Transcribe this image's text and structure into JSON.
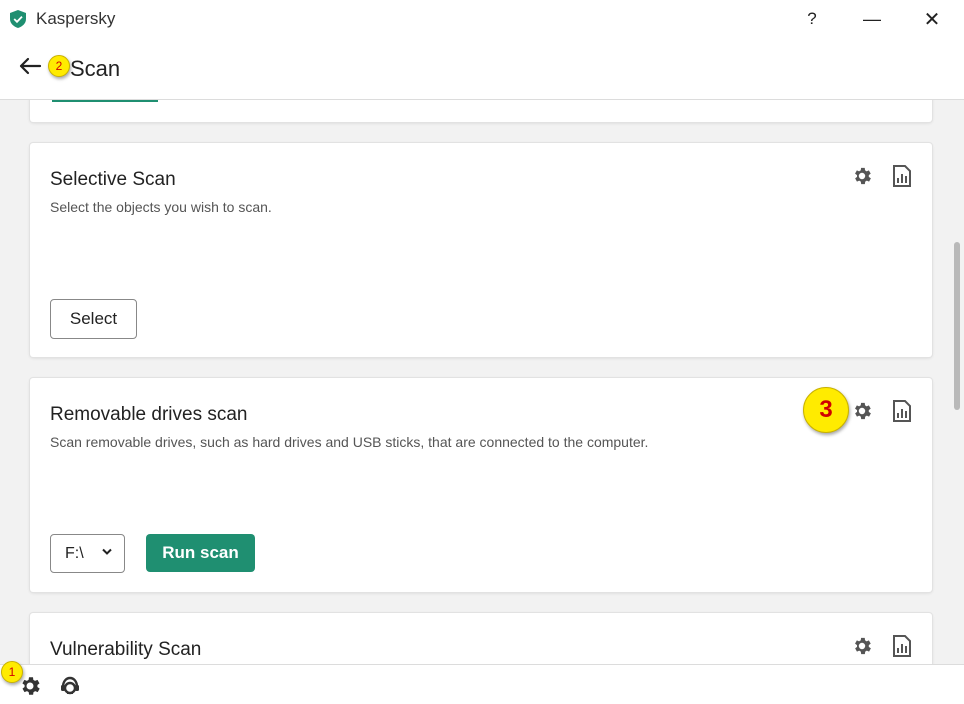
{
  "window": {
    "title": "Kaspersky",
    "help_label": "?",
    "minimize_label": "—",
    "close_label": "✕"
  },
  "header": {
    "title": "Scan"
  },
  "annotations": {
    "marker_1": "1",
    "marker_2": "2",
    "marker_3": "3"
  },
  "cards": {
    "selective": {
      "title": "Selective Scan",
      "description": "Select the objects you wish to scan.",
      "button_label": "Select"
    },
    "removable": {
      "title": "Removable drives scan",
      "description": "Scan removable drives, such as hard drives and USB sticks, that are connected to the computer.",
      "drive_value": "F:\\",
      "run_label": "Run scan"
    },
    "vulnerability": {
      "title": "Vulnerability Scan"
    }
  },
  "colors": {
    "accent": "#1f8f71",
    "marker": "#ffeb00",
    "marker_text": "#d00000"
  },
  "icons": {
    "settings": "gear-icon",
    "reports": "report-icon",
    "support": "support-icon",
    "back": "arrow-left-icon",
    "logo": "shield-check-icon"
  }
}
